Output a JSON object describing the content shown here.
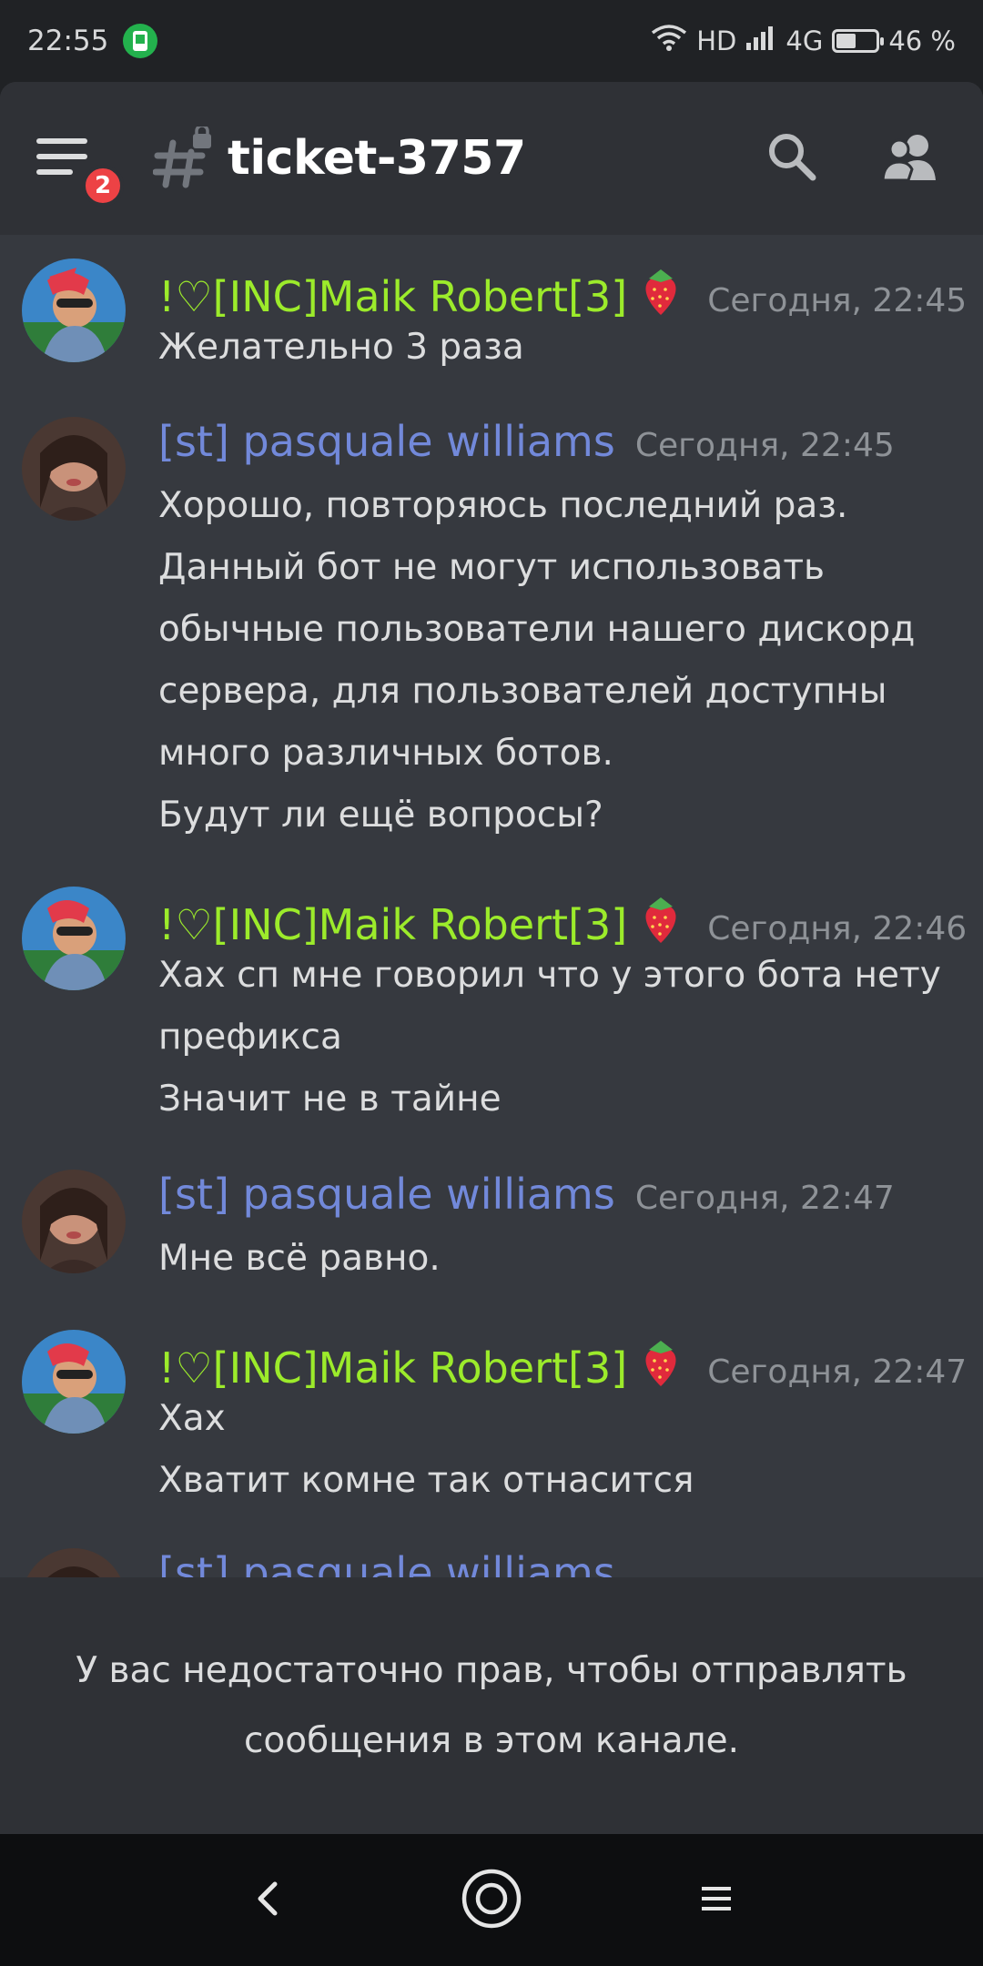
{
  "status_bar": {
    "time": "22:55",
    "network_hd": "HD",
    "network_type": "4G",
    "battery_percent": "46 %",
    "battery_level": 0.46
  },
  "header": {
    "channel_name": "ticket-3757",
    "mention_count": "2"
  },
  "messages": [
    {
      "author": "!♡[INC]Maik Robert[3]",
      "author_color": "#9ceb2b",
      "time": "Сегодня, 22:45",
      "lines": [
        "Желательно 3 раза"
      ]
    },
    {
      "author": "[st] pasquale williams",
      "author_color": "#7289da",
      "time": "Сегодня, 22:45",
      "lines": [
        "Хорошо, повторяюсь последний раз.",
        "Данный бот не могут использовать",
        "обычные пользователи нашего дискорд",
        "сервера, для пользователей доступны",
        "много различных ботов.",
        "Будут ли ещё вопросы?"
      ]
    },
    {
      "author": "!♡[INC]Maik Robert[3]",
      "author_color": "#9ceb2b",
      "time": "Сегодня, 22:46",
      "lines": [
        "Хах сп мне говорил что у этого бота нету",
        "префикса",
        "Значит не в тайне"
      ]
    },
    {
      "author": "[st] pasquale williams",
      "author_color": "#7289da",
      "time": "Сегодня, 22:47",
      "lines": [
        "Мне всё равно."
      ]
    },
    {
      "author": "!♡[INC]Maik Robert[3]",
      "author_color": "#9ceb2b",
      "time": "Сегодня, 22:47",
      "lines": [
        "Хах",
        "Хватит комне так отнасится"
      ]
    },
    {
      "author": "[st] pasquale williams",
      "author_color": "#7289da",
      "time": "",
      "lines": []
    }
  ],
  "notice": {
    "line1": "У вас недостаточно прав, чтобы отправлять",
    "line2": "сообщения в этом канале."
  },
  "colors": {
    "background": "#36393f",
    "header": "#2f3136",
    "maik_name": "#9ceb2b",
    "pasquale_name": "#7289da",
    "badge": "#ed4245"
  },
  "icons": [
    "hamburger-menu-icon",
    "text-channel-locked-icon",
    "search-icon",
    "members-icon",
    "strawberry-emoji",
    "back-icon",
    "home-icon",
    "recents-icon"
  ]
}
